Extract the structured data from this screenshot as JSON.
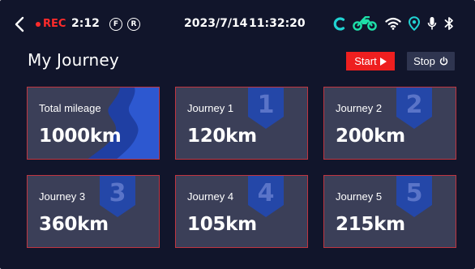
{
  "status_bar": {
    "rec_label": "REC",
    "rec_time": "2:12",
    "indicator_f": "F",
    "indicator_r": "R",
    "date": "2023/7/14",
    "time": "11:32:20",
    "colors": {
      "rec": "#ff2b2b",
      "connect": "#21d3d3",
      "motorcycle": "#1ee0a8",
      "location": "#21d3d3"
    },
    "icons": [
      "back-arrow-icon",
      "connect-icon",
      "motorcycle-icon",
      "wifi-icon",
      "location-icon",
      "microphone-icon",
      "bluetooth-icon"
    ]
  },
  "header": {
    "title": "My Journey",
    "start_label": "Start",
    "stop_label": "Stop"
  },
  "cards": [
    {
      "label": "Total mileage",
      "value": "1000km"
    },
    {
      "label": "Journey 1",
      "value": "120km",
      "badge": "1"
    },
    {
      "label": "Journey 2",
      "value": "200km",
      "badge": "2"
    },
    {
      "label": "Journey 3",
      "value": "360km",
      "badge": "3"
    },
    {
      "label": "Journey 4",
      "value": "105km",
      "badge": "4"
    },
    {
      "label": "Journey 5",
      "value": "215km",
      "badge": "5"
    }
  ],
  "theme": {
    "background": "#11152b",
    "card_background": "#3b3f58",
    "card_border": "#c03540",
    "badge_blue": "#2447a8",
    "start_red": "#ee1f1f",
    "stop_gray": "#2f3550"
  }
}
